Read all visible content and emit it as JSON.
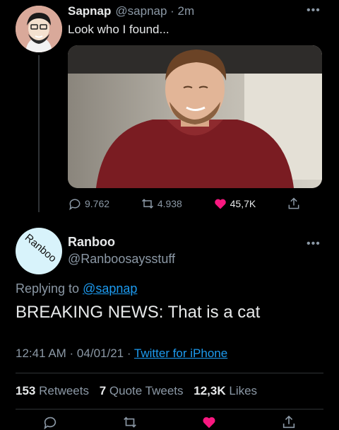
{
  "parent_tweet": {
    "display_name": "Sapnap",
    "handle_time": "@sapnap · 2m",
    "text": "Look who I found...",
    "replies": "9.762",
    "retweets": "4.938",
    "likes": "45,7K",
    "more_icon": "more-horizontal-icon"
  },
  "main_tweet": {
    "avatar_text": "Ranboo",
    "display_name": "Ranboo",
    "handle": "@Ranboosaysstuff",
    "replying_prefix": "Replying to",
    "replying_mention": "@sapnap",
    "text": "BREAKING NEWS: That is a cat",
    "time": "12:41 AM · 04/01/21 ·",
    "client": "Twitter for iPhone",
    "retweets_count": "153",
    "retweets_label": "Retweets",
    "quotes_count": "7",
    "quotes_label": "Quote Tweets",
    "likes_count": "12,3K",
    "likes_label": "Likes"
  },
  "colors": {
    "background": "#000000",
    "accent": "#1d9bf0",
    "like": "#f91880",
    "secondary_text": "#8b98a5"
  }
}
